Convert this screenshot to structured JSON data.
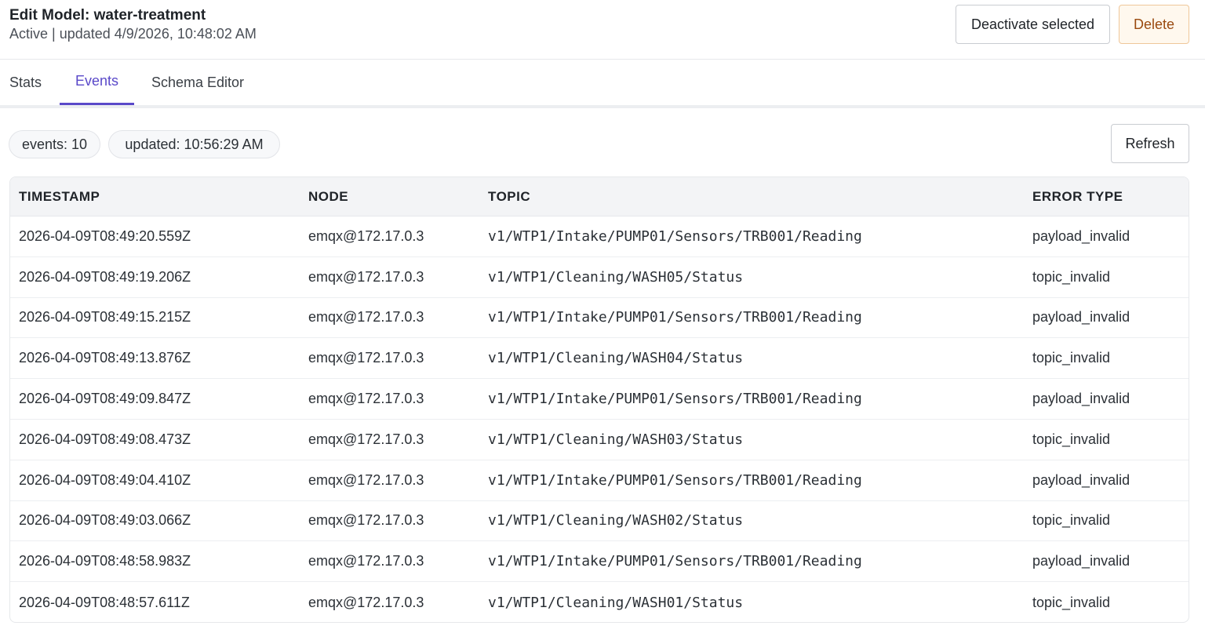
{
  "header": {
    "title": "Edit Model: water-treatment",
    "subtitle": "Active | updated 4/9/2026, 10:48:02 AM",
    "deactivate_label": "Deactivate selected",
    "delete_label": "Delete"
  },
  "tabs": [
    {
      "label": "Stats",
      "active": false
    },
    {
      "label": "Events",
      "active": true
    },
    {
      "label": "Schema Editor",
      "active": false
    }
  ],
  "toolbar": {
    "events_count": "events: 10",
    "updated": "updated: 10:56:29 AM",
    "refresh_label": "Refresh"
  },
  "table": {
    "columns": [
      "TIMESTAMP",
      "NODE",
      "TOPIC",
      "ERROR TYPE"
    ],
    "rows": [
      {
        "timestamp": "2026-04-09T08:49:20.559Z",
        "node": "emqx@172.17.0.3",
        "topic": "v1/WTP1/Intake/PUMP01/Sensors/TRB001/Reading",
        "error": "payload_invalid"
      },
      {
        "timestamp": "2026-04-09T08:49:19.206Z",
        "node": "emqx@172.17.0.3",
        "topic": "v1/WTP1/Cleaning/WASH05/Status",
        "error": "topic_invalid"
      },
      {
        "timestamp": "2026-04-09T08:49:15.215Z",
        "node": "emqx@172.17.0.3",
        "topic": "v1/WTP1/Intake/PUMP01/Sensors/TRB001/Reading",
        "error": "payload_invalid"
      },
      {
        "timestamp": "2026-04-09T08:49:13.876Z",
        "node": "emqx@172.17.0.3",
        "topic": "v1/WTP1/Cleaning/WASH04/Status",
        "error": "topic_invalid"
      },
      {
        "timestamp": "2026-04-09T08:49:09.847Z",
        "node": "emqx@172.17.0.3",
        "topic": "v1/WTP1/Intake/PUMP01/Sensors/TRB001/Reading",
        "error": "payload_invalid"
      },
      {
        "timestamp": "2026-04-09T08:49:08.473Z",
        "node": "emqx@172.17.0.3",
        "topic": "v1/WTP1/Cleaning/WASH03/Status",
        "error": "topic_invalid"
      },
      {
        "timestamp": "2026-04-09T08:49:04.410Z",
        "node": "emqx@172.17.0.3",
        "topic": "v1/WTP1/Intake/PUMP01/Sensors/TRB001/Reading",
        "error": "payload_invalid"
      },
      {
        "timestamp": "2026-04-09T08:49:03.066Z",
        "node": "emqx@172.17.0.3",
        "topic": "v1/WTP1/Cleaning/WASH02/Status",
        "error": "topic_invalid"
      },
      {
        "timestamp": "2026-04-09T08:48:58.983Z",
        "node": "emqx@172.17.0.3",
        "topic": "v1/WTP1/Intake/PUMP01/Sensors/TRB001/Reading",
        "error": "payload_invalid"
      },
      {
        "timestamp": "2026-04-09T08:48:57.611Z",
        "node": "emqx@172.17.0.3",
        "topic": "v1/WTP1/Cleaning/WASH01/Status",
        "error": "topic_invalid"
      }
    ]
  },
  "colors": {
    "accent": "#5a49c9",
    "delete_text": "#9a4a10",
    "delete_bg": "#fff8ee"
  }
}
